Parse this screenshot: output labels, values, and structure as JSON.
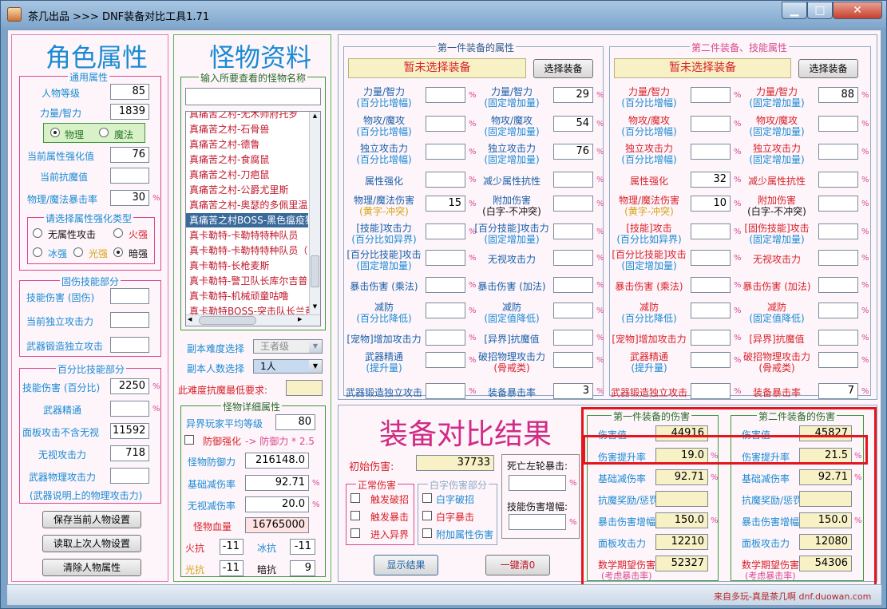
{
  "window": {
    "title": "茶几出品 >>> DNF装备对比工具1.71",
    "min_icon": "minimize-icon",
    "max_icon": "maximize-icon",
    "close_icon": "close-icon",
    "close_glyph": "✕"
  },
  "role": {
    "title": "角色属性",
    "general": {
      "legend": "通用属性",
      "level_label": "人物等级",
      "level_value": "85",
      "str_label": "力量/智力",
      "str_value": "1839",
      "phys_label": "物理",
      "magic_label": "魔法",
      "selected": "物理",
      "elem_enh_label": "当前属性强化值",
      "elem_enh_value": "76",
      "anti_label": "当前抗魔值",
      "anti_value": "",
      "crit_label": "物理/魔法暴击率",
      "crit_value": "30"
    },
    "elem_type": {
      "legend": "请选择属性强化类型",
      "none": "无属性攻击",
      "fire": "火强",
      "ice": "冰强",
      "light": "光强",
      "dark": "暗强",
      "selected": "暗强"
    },
    "fixed_skill": {
      "legend": "固伤技能部分",
      "skill_dmg_label": "技能伤害 (固伤)",
      "skill_dmg_value": "",
      "indep_label": "当前独立攻击力",
      "indep_value": "",
      "weapon_forge_label": "武器锻造独立攻击",
      "weapon_forge_value": ""
    },
    "pct_skill": {
      "legend": "百分比技能部分",
      "skill_dmg_label": "技能伤害 (百分比)",
      "skill_dmg_value": "2250",
      "mastery_label": "武器精通",
      "mastery_value": "",
      "panel_label": "面板攻击不含无视",
      "panel_value": "11592",
      "ignore_label": "无视攻击力",
      "ignore_value": "718",
      "weapon_atk_label": "武器物理攻击力",
      "weapon_atk_value": "",
      "note": "(武器说明上的物理攻击力)"
    },
    "buttons": {
      "save": "保存当前人物设置",
      "load": "读取上次人物设置",
      "clear": "清除人物属性"
    }
  },
  "monster": {
    "title": "怪物资料",
    "search_legend": "输入所要查看的怪物名称",
    "search_value": "",
    "list_items": [
      "真痛苦之村-无木师府托罗",
      "真痛苦之村-石骨兽",
      "真痛苦之村-德鲁",
      "真痛苦之村-食腐鼠",
      "真痛苦之村-刀疤鼠",
      "真痛苦之村-公爵尤里斯",
      "真痛苦之村-奥瑟的多佩里温",
      "真痛苦之村BOSS-黑色瘟疫狄",
      "真卡勒特-卡勒特特种队员",
      "真卡勒特-卡勒特特种队员（",
      "真卡勒特-长枪麦斯",
      "真卡勒特-警卫队长库尔吉普",
      "真卡勒特-机械顽童咕噜",
      "真卡勒特BOSS-突击队长兰蒂"
    ],
    "selected_index": 7,
    "difficulty_label": "副本难度选择",
    "difficulty_value": "王者级",
    "players_label": "副本人数选择",
    "players_value": "1人",
    "req_label": "此难度抗魔最低要求:",
    "req_value": "",
    "detail": {
      "legend": "怪物详细属性",
      "avg_level_label": "异界玩家平均等级",
      "avg_level_value": "80",
      "def_enh_label": "防御强化",
      "def_enh_formula": "-> 防御力 * 2.5",
      "def_label": "怪物防御力",
      "def_value": "216148.0",
      "base_red_label": "基础减伤率",
      "base_red_value": "92.71",
      "ign_red_label": "无视减伤率",
      "ign_red_value": "20.0",
      "hp_label": "怪物血量",
      "hp_value": "16765000",
      "fire_label": "火抗",
      "fire_value": "-11",
      "ice_label": "冰抗",
      "ice_value": "-11",
      "light_label": "光抗",
      "light_value": "-11",
      "dark_label": "暗抗",
      "dark_value": "9"
    }
  },
  "equip1": {
    "legend": "第一件装备的属性",
    "name": "暂未选择装备",
    "select_btn": "选择装备",
    "rows": [
      {
        "l1": "力量/智力",
        "s1": "(百分比增幅)",
        "v1": "",
        "l2": "力量/智力",
        "s2": "(固定增加量)",
        "v2": "29"
      },
      {
        "l1": "物攻/魔攻",
        "s1": "(百分比增幅)",
        "v1": "",
        "l2": "物攻/魔攻",
        "s2": "(固定增加量)",
        "v2": "54"
      },
      {
        "l1": "独立攻击力",
        "s1": "(百分比增幅)",
        "v1": "",
        "l2": "独立攻击力",
        "s2": "(固定增加量)",
        "v2": "76"
      },
      {
        "l1": "属性强化",
        "s1": "",
        "v1": "",
        "l2": "减少属性抗性",
        "s2": "",
        "v2": ""
      },
      {
        "l1": "物理/魔法伤害",
        "s1": "(黄字-冲突)",
        "v1": "15",
        "l2": "附加伤害",
        "s2": "(白字-不冲突)",
        "v2": ""
      },
      {
        "l1": "[技能]攻击力",
        "s1": "(百分比如异界)",
        "v1": "",
        "l2": "[百分技能]攻击力",
        "s2": "(固定增加量)",
        "v2": ""
      },
      {
        "l1": "[百分比技能]攻击",
        "s1": "(固定增加量)",
        "v1": "",
        "l2": "无视攻击力",
        "s2": "",
        "v2": ""
      },
      {
        "l1": "暴击伤害 (乘法)",
        "s1": "",
        "v1": "",
        "l2": "暴击伤害 (加法)",
        "s2": "",
        "v2": ""
      },
      {
        "l1": "减防",
        "s1": "(百分比降低)",
        "v1": "",
        "l2": "减防",
        "s2": "(固定值降低)",
        "v2": ""
      },
      {
        "l1": "[宠物]增加攻击力",
        "s1": "",
        "v1": "",
        "l2": "[异界]抗魔值",
        "s2": "",
        "v2": ""
      },
      {
        "l1": "武器精通",
        "s1": "(提升量)",
        "v1": "",
        "l2": "破招物理攻击力",
        "s2": "(骨戒类)",
        "v2": ""
      },
      {
        "l1": "武器锻造独立攻击",
        "s1": "",
        "v1": "",
        "l2": "装备暴击率",
        "s2": "",
        "v2": "3"
      }
    ]
  },
  "equip2": {
    "legend": "第二件装备、技能属性",
    "name": "暂未选择装备",
    "select_btn": "选择装备",
    "rows": [
      {
        "l1": "力量/智力",
        "s1": "(百分比增幅)",
        "v1": "",
        "l2": "力量/智力",
        "s2": "(固定增加量)",
        "v2": "88"
      },
      {
        "l1": "物攻/魔攻",
        "s1": "(百分比增幅)",
        "v1": "",
        "l2": "物攻/魔攻",
        "s2": "(固定增加量)",
        "v2": ""
      },
      {
        "l1": "独立攻击力",
        "s1": "(百分比增幅)",
        "v1": "",
        "l2": "独立攻击力",
        "s2": "(固定增加量)",
        "v2": ""
      },
      {
        "l1": "属性强化",
        "s1": "",
        "v1": "32",
        "l2": "减少属性抗性",
        "s2": "",
        "v2": ""
      },
      {
        "l1": "物理/魔法伤害",
        "s1": "(黄字-冲突)",
        "v1": "10",
        "l2": "附加伤害",
        "s2": "(白字-不冲突)",
        "v2": ""
      },
      {
        "l1": "[技能]攻击",
        "s1": "(百分比如异界)",
        "v1": "",
        "l2": "[固伤技能]攻击",
        "s2": "(固定增加量)",
        "v2": ""
      },
      {
        "l1": "[百分比技能]攻击",
        "s1": "(固定增加量)",
        "v1": "",
        "l2": "无视攻击力",
        "s2": "",
        "v2": ""
      },
      {
        "l1": "暴击伤害 (乘法)",
        "s1": "",
        "v1": "",
        "l2": "暴击伤害 (加法)",
        "s2": "",
        "v2": ""
      },
      {
        "l1": "减防",
        "s1": "(百分比降低)",
        "v1": "",
        "l2": "减防",
        "s2": "(固定值降低)",
        "v2": ""
      },
      {
        "l1": "[宠物]增加攻击力",
        "s1": "",
        "v1": "",
        "l2": "[异界]抗魔值",
        "s2": "",
        "v2": ""
      },
      {
        "l1": "武器精通",
        "s1": "(提升量)",
        "v1": "",
        "l2": "破招物理攻击力",
        "s2": "(骨戒类)",
        "v2": ""
      },
      {
        "l1": "武器锻造独立攻击",
        "s1": "",
        "v1": "",
        "l2": "装备暴击率",
        "s2": "",
        "v2": "7"
      }
    ]
  },
  "result": {
    "title": "装备对比结果",
    "init_label": "初始伤害:",
    "init_value": "37733",
    "normal": {
      "legend": "正常伤害",
      "trigger_break": "触发破招",
      "trigger_crit": "触发暴击",
      "enter_other": "进入异界"
    },
    "white": {
      "legend": "白字伤害部分",
      "white_break": "白字破招",
      "white_crit": "白字暴击",
      "extra_attr": "附加属性伤害"
    },
    "death_crit_label": "死亡左轮暴击:",
    "death_crit_value": "",
    "skill_amp_label": "技能伤害增幅:",
    "skill_amp_value": "",
    "show_btn": "显示结果",
    "clear_btn": "一键清0",
    "eq1": {
      "legend": "第一件装备的伤害",
      "dmg_label": "伤害值",
      "dmg_value": "44916",
      "up_label": "伤害提升率",
      "up_value": "19.0",
      "red_label": "基础减伤率",
      "red_value": "92.71",
      "anti_label": "抗魔奖励/惩罚",
      "anti_value": "",
      "critup_label": "暴击伤害增幅率",
      "critup_value": "150.0",
      "panel_label": "面板攻击力",
      "panel_value": "12210",
      "exp_label": "数学期望伤害",
      "exp_sub": "(考虑暴击率)",
      "exp_value": "52327"
    },
    "eq2": {
      "legend": "第二件装备的伤害",
      "dmg_label": "伤害值",
      "dmg_value": "45827",
      "up_label": "伤害提升率",
      "up_value": "21.5",
      "red_label": "基础减伤率",
      "red_value": "92.71",
      "anti_label": "抗魔奖励/惩罚",
      "anti_value": "",
      "critup_label": "暴击伤害增幅率",
      "critup_value": "150.0",
      "panel_label": "面板攻击力",
      "panel_value": "12080",
      "exp_label": "数学期望伤害",
      "exp_sub": "(考虑暴击率)",
      "exp_value": "54306"
    },
    "pct": "%"
  },
  "footer": "来自多玩-真是茶几啊 dnf.duowan.com",
  "colors": {
    "accent_blue": "#1a8ad3",
    "accent_pink": "#d8498f",
    "highlight_red": "#e3151d",
    "list_text": "#c0192d",
    "result_field": "#f7f1c5"
  }
}
